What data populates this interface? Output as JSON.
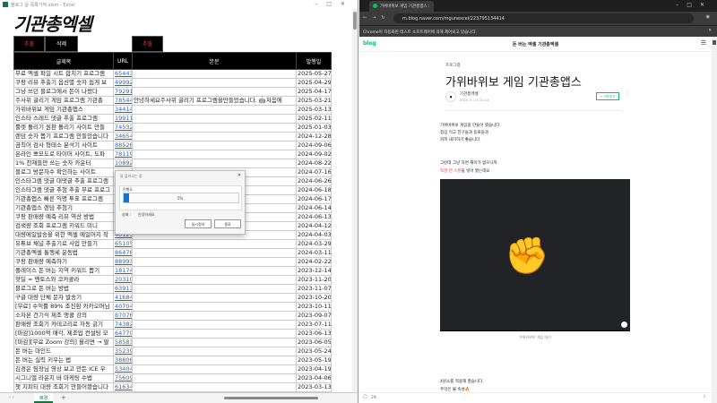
{
  "excel": {
    "window_title": "블로그 글 목록가져.xlsm - Excel",
    "logo": "기관총엑셀",
    "buttons": {
      "extract1": "추출",
      "delete": "삭제",
      "extract2": "추출"
    },
    "columns": [
      "글제목",
      "URL",
      "본문",
      "발행일"
    ],
    "rows": [
      [
        "무료 엑셀 파일 시트 합치기 프로그램",
        "65443",
        "",
        "2025-05-27"
      ],
      [
        "쿠팡 리뷰 추출기 옵션별 숫자 쉽게 보",
        "49992",
        "",
        "2025-04-29"
      ],
      [
        "그냥 쓰던 블로그에서 돈이 나왔다",
        "79291",
        "",
        "2025-04-17"
      ],
      [
        "주사위 굴리기 게임 프로그램 기관총",
        "78544",
        "안녕하세요주사위 굴리기 프로그램을만들었습니다. 🤖처음에",
        "2025-03-21"
      ],
      [
        "가위바위보 게임 기관총앱스",
        "34414",
        "",
        "2025-03-13"
      ],
      [
        "인스타 스레드 댓글 추출 프로그램",
        "19911",
        "",
        "2025-02-11"
      ],
      [
        "룰렛 돌리기 원판 돌리기 사이트 만들",
        "74532",
        "",
        "2025-01-03"
      ],
      [
        "랜덤 숫자 뽑기 프로그램 만들었습니다",
        "34654",
        "",
        "2024-12-28"
      ],
      [
        "금칙어 검사 형태소 분석기 사이트",
        "88526",
        "",
        "2024-09-06"
      ],
      [
        "온라인 뽀모도로 타이머 사이트, 도파",
        "78119",
        "",
        "2024-09-02"
      ],
      [
        "1% 천재들만 쓰는 숫자 카운터",
        "10892",
        "",
        "2024-08-22"
      ],
      [
        "블로그 방문자수 확인하는 사이트",
        "",
        "",
        "2024-07-16"
      ],
      [
        "인스타그램 댓글 대댓글 추출 프로그램",
        "",
        "",
        "2024-06-26"
      ],
      [
        "인스타그램 댓글 추첨 추출 무료 프로그",
        "",
        "",
        "2024-06-18"
      ],
      [
        "기관총앱스 빠른 익명 투표 프로그램",
        "",
        "",
        "2024-06-17"
      ],
      [
        "기관총앱스 랜덤 추첨기",
        "",
        "",
        "2024-06-14"
      ],
      [
        "쿠팡 판매량 예측 리뷰 역산 방법",
        "",
        "",
        "2024-06-13"
      ],
      [
        "검색량 조회 프로그램 키워드 미니",
        "",
        "",
        "2024-04-12"
      ],
      [
        "대량메일발송을 위한 엑셀 메일머지 작",
        "40123",
        "",
        "2024-04-03"
      ],
      [
        "유튜브 채널 추출기로 사업 만들기",
        "65105",
        "",
        "2024-03-29"
      ],
      [
        "기관총엑셀 통행세 운동법",
        "86478",
        "",
        "2024-03-11"
      ],
      [
        "쿠팡 판매량 예측하기",
        "88993",
        "",
        "2024-02-22"
      ],
      [
        "플레이스 돈 버는 지역 키워드 뽑기",
        "18174",
        "",
        "2023-12-14"
      ],
      [
        "핫딜 = 멘토스와 코카콜라",
        "20310",
        "",
        "2023-11-20"
      ],
      [
        "블로그로 돈 버는 방법",
        "63913",
        "",
        "2023-11-07"
      ],
      [
        "구글 대량 단체 문자 발송기",
        "41684",
        "",
        "2023-10-20"
      ],
      [
        "[무료] 수익률 89% 조진환 카카오머님",
        "40704",
        "",
        "2023-10-11"
      ],
      [
        "소자본 건기식 제조 앵콜 강의",
        "87076",
        "",
        "2023-09-07"
      ],
      [
        "판매량 조회기 카테고리로 자동 긁기",
        "74382",
        "",
        "2023-07-11"
      ],
      [
        "[마감]1000억 매각, 제조업 컨설팅 모",
        "64770",
        "",
        "2023-06-13"
      ],
      [
        "[마감][무료 Zoom 강의] 올리면 → 팔",
        "58583",
        "",
        "2023-06-05"
      ],
      [
        "돈 버는 마인드",
        "35239",
        "",
        "2023-05-24"
      ],
      [
        "돈 버는 실력 키우는 법",
        "38806",
        "",
        "2023-05-19"
      ],
      [
        "김경은 팀장님 영상 보고 만든 ICE 우",
        "53404",
        "",
        "2023-04-19"
      ],
      [
        "시그니엘 라운지 바 마케팅 수법",
        "75609",
        "",
        "2023-04-06"
      ],
      [
        "챗 지피티 대량 조회기 만들어봤습니다",
        "61634",
        "",
        "2023-03-13"
      ]
    ],
    "sheet_tab": "배경",
    "add_sheet": "+"
  },
  "dialog": {
    "title": "글 불러오는 중",
    "progress_label": "진행도",
    "percent_text": "5%",
    "progress": 5,
    "status": "상태 :",
    "status_value": "안녕하세요",
    "pause": "일시정지",
    "close": "종료",
    "accent": "#1474d4"
  },
  "browser": {
    "tab_title": "가위바위보 게임 기관총앱스 :",
    "url": "m.blog.naver.com/mgunexcel/223795134414",
    "infobar": "Chrome이 자동화된 테스트 소프트웨어에 의해 제어되고 있습니다.",
    "blog_logo": "blog",
    "blog_name": "돈 버는 엑셀 기관총엑셀",
    "category": "프로그램",
    "post_title": "가위바위보 게임 기관총앱스",
    "author": "기관총엑셀",
    "date": "2025. 3. 13. 22:14",
    "neighbor_button": "+ 이웃추가",
    "body": [
      "가위바위보 게임을 만들어 봤습니다.",
      "점심 먹고 친구들과 동료들과",
      "커피 내기하기 좋습니다."
    ],
    "body2": "그런데 그냥 하면 재미가 없으니까",
    "body3_red": "직관 한 스푼",
    "body3_rest": "을 넣어 봤는데요",
    "caption": "가위바위보 게임 대기",
    "body4": [
      "4원소를 적용해 봤습니다.",
      "주먹은 불 속성🔥"
    ],
    "comments": "29",
    "brand_color": "#03c75a"
  }
}
